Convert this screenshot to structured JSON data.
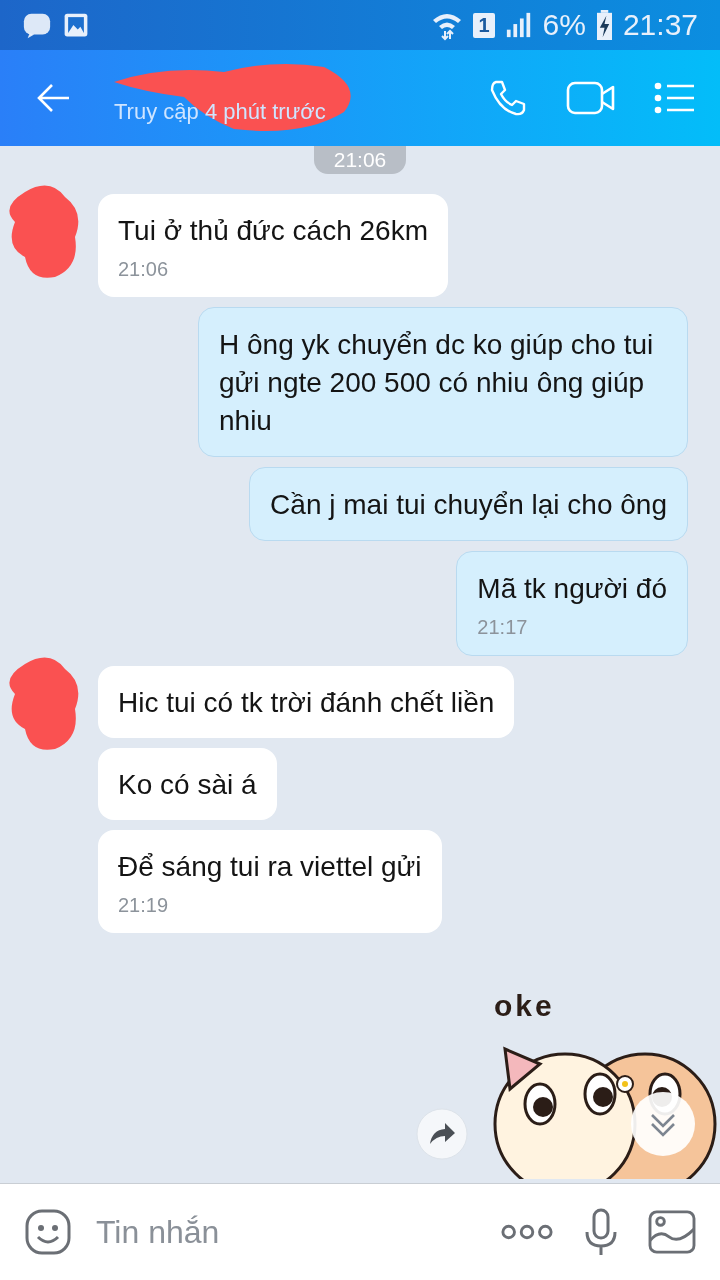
{
  "status_bar": {
    "sim": "1",
    "battery": "6%",
    "time": "21:37"
  },
  "header": {
    "status": "Truy cập 4 phút trước"
  },
  "chat": {
    "time_pill": "21:06",
    "messages": [
      {
        "kind": "incoming",
        "avatar": true,
        "text": "Tui ở thủ đức cách 26km",
        "time": "21:06"
      },
      {
        "kind": "outgoing",
        "text": "H ông yk chuyển dc ko giúp cho tui gửi ngte 200 500 có nhiu ông giúp nhiu"
      },
      {
        "kind": "outgoing",
        "text": "Cần j mai tui chuyển lại cho ông"
      },
      {
        "kind": "outgoing",
        "text": "Mã tk người đó",
        "time": "21:17"
      },
      {
        "kind": "incoming",
        "avatar": true,
        "text": "Hic tui có tk trời đánh chết liền"
      },
      {
        "kind": "incoming",
        "avatar": false,
        "text": "Ko có sài á"
      },
      {
        "kind": "incoming",
        "avatar": false,
        "text": "Để sáng tui ra viettel gửi",
        "time": "21:19"
      }
    ],
    "sticker": {
      "caption": "oke"
    }
  },
  "composer": {
    "placeholder": "Tin nhắn"
  }
}
